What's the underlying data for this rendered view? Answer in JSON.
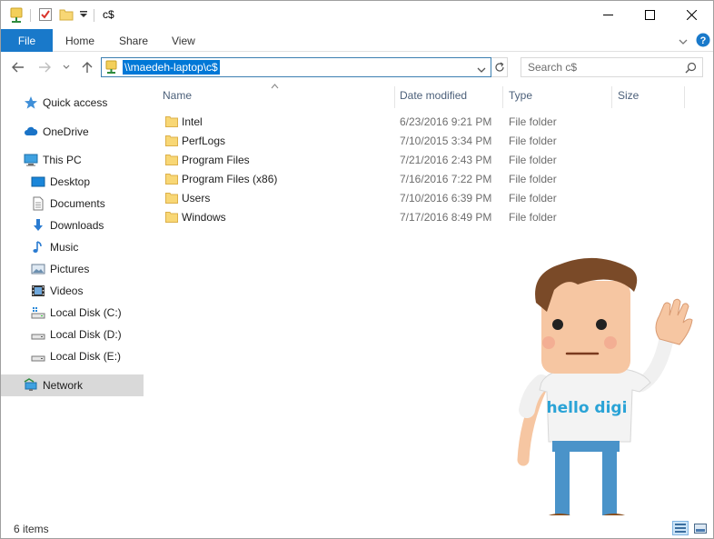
{
  "window": {
    "title": "c$",
    "controls": {
      "minimize": "minimize",
      "maximize": "maximize",
      "close": "close"
    }
  },
  "ribbon": {
    "tabs": [
      {
        "label": "File"
      },
      {
        "label": "Home"
      },
      {
        "label": "Share"
      },
      {
        "label": "View"
      }
    ]
  },
  "address": {
    "path": "\\\\maedeh-laptop\\c$",
    "search_placeholder": "Search c$"
  },
  "navigation": {
    "items": [
      {
        "label": "Quick access",
        "icon": "star-icon"
      },
      {
        "label": "OneDrive",
        "icon": "cloud-icon"
      },
      {
        "label": "This PC",
        "icon": "computer-icon"
      },
      {
        "label": "Desktop",
        "icon": "desktop-icon"
      },
      {
        "label": "Documents",
        "icon": "documents-icon"
      },
      {
        "label": "Downloads",
        "icon": "download-icon"
      },
      {
        "label": "Music",
        "icon": "music-icon"
      },
      {
        "label": "Pictures",
        "icon": "pictures-icon"
      },
      {
        "label": "Videos",
        "icon": "videos-icon"
      },
      {
        "label": "Local Disk (C:)",
        "icon": "drive-icon"
      },
      {
        "label": "Local Disk (D:)",
        "icon": "drive-icon"
      },
      {
        "label": "Local Disk (E:)",
        "icon": "drive-icon"
      },
      {
        "label": "Network",
        "icon": "network-icon",
        "selected": true
      }
    ]
  },
  "file_list": {
    "columns": [
      "Name",
      "Date modified",
      "Type",
      "Size"
    ],
    "rows": [
      {
        "name": "Intel",
        "date": "6/23/2016 9:21 PM",
        "type": "File folder"
      },
      {
        "name": "PerfLogs",
        "date": "7/10/2015 3:34 PM",
        "type": "File folder"
      },
      {
        "name": "Program Files",
        "date": "7/21/2016 2:43 PM",
        "type": "File folder"
      },
      {
        "name": "Program Files (x86)",
        "date": "7/16/2016 7:22 PM",
        "type": "File folder"
      },
      {
        "name": "Users",
        "date": "7/10/2016 6:39 PM",
        "type": "File folder"
      },
      {
        "name": "Windows",
        "date": "7/17/2016 8:49 PM",
        "type": "File folder"
      }
    ]
  },
  "status": {
    "item_count": "6 items"
  },
  "mascot": {
    "shirt_text": "hello digi"
  },
  "colors": {
    "accent": "#1979ca",
    "selection": "#0078d7",
    "folder": "#f8d775",
    "shirt_text": "#2aa3d6"
  }
}
